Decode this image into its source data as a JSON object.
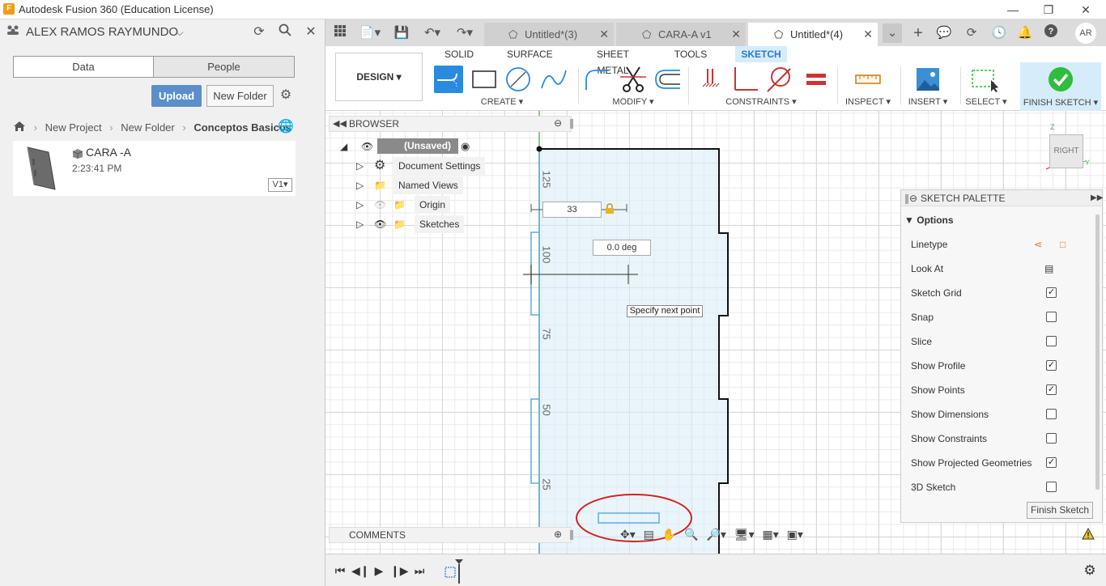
{
  "window": {
    "title": "Autodesk Fusion 360 (Education License)",
    "app_icon": "F"
  },
  "datapanel": {
    "user": "ALEX RAMOS RAYMUNDO",
    "tabs": [
      "Data",
      "People"
    ],
    "upload": "Upload",
    "new_folder": "New Folder",
    "breadcrumb": [
      "New Project",
      "New Folder",
      "Conceptos Basicos"
    ],
    "file": {
      "name": "CARA -A",
      "time": "2:23:41 PM",
      "version": "V1"
    }
  },
  "doc_tabs": [
    {
      "label": "Untitled*(3)"
    },
    {
      "label": "CARA-A v1"
    },
    {
      "label": "Untitled*(4)"
    }
  ],
  "user_initials": "AR",
  "ribbon": {
    "workspace": "DESIGN",
    "tabs": [
      "SOLID",
      "SURFACE",
      "SHEET METAL",
      "TOOLS",
      "SKETCH"
    ],
    "groups": [
      "CREATE",
      "MODIFY",
      "CONSTRAINTS",
      "INSPECT",
      "INSERT",
      "SELECT",
      "FINISH SKETCH"
    ]
  },
  "browser": {
    "title": "BROWSER",
    "root": "(Unsaved)",
    "items": [
      "Document Settings",
      "Named Views",
      "Origin",
      "Sketches"
    ]
  },
  "comments": {
    "title": "COMMENTS"
  },
  "canvas": {
    "ruler_labels": [
      "125",
      "100",
      "75",
      "50",
      "25"
    ],
    "dim_length": "33",
    "dim_angle": "0.0 deg",
    "tooltip": "Specify next point",
    "viewcube": "RIGHT",
    "axis_z": "Z",
    "axis_y": "Y"
  },
  "palette": {
    "title": "SKETCH PALETTE",
    "section": "Options",
    "rows": [
      {
        "label": "Linetype",
        "type": "icons"
      },
      {
        "label": "Look At",
        "type": "icon"
      },
      {
        "label": "Sketch Grid",
        "checked": "✓"
      },
      {
        "label": "Snap",
        "checked": ""
      },
      {
        "label": "Slice",
        "checked": ""
      },
      {
        "label": "Show Profile",
        "checked": "✓"
      },
      {
        "label": "Show Points",
        "checked": "✓"
      },
      {
        "label": "Show Dimensions",
        "checked": ""
      },
      {
        "label": "Show Constraints",
        "checked": ""
      },
      {
        "label": "Show Projected Geometries",
        "checked": "✓"
      },
      {
        "label": "3D Sketch",
        "checked": ""
      }
    ],
    "finish_button": "Finish Sketch"
  },
  "colors": {
    "accent": "#2a7ad5",
    "sketch_blue": "#5aa9d6",
    "annotation_red": "#d22222",
    "finish_green": "#2ebd3c"
  }
}
